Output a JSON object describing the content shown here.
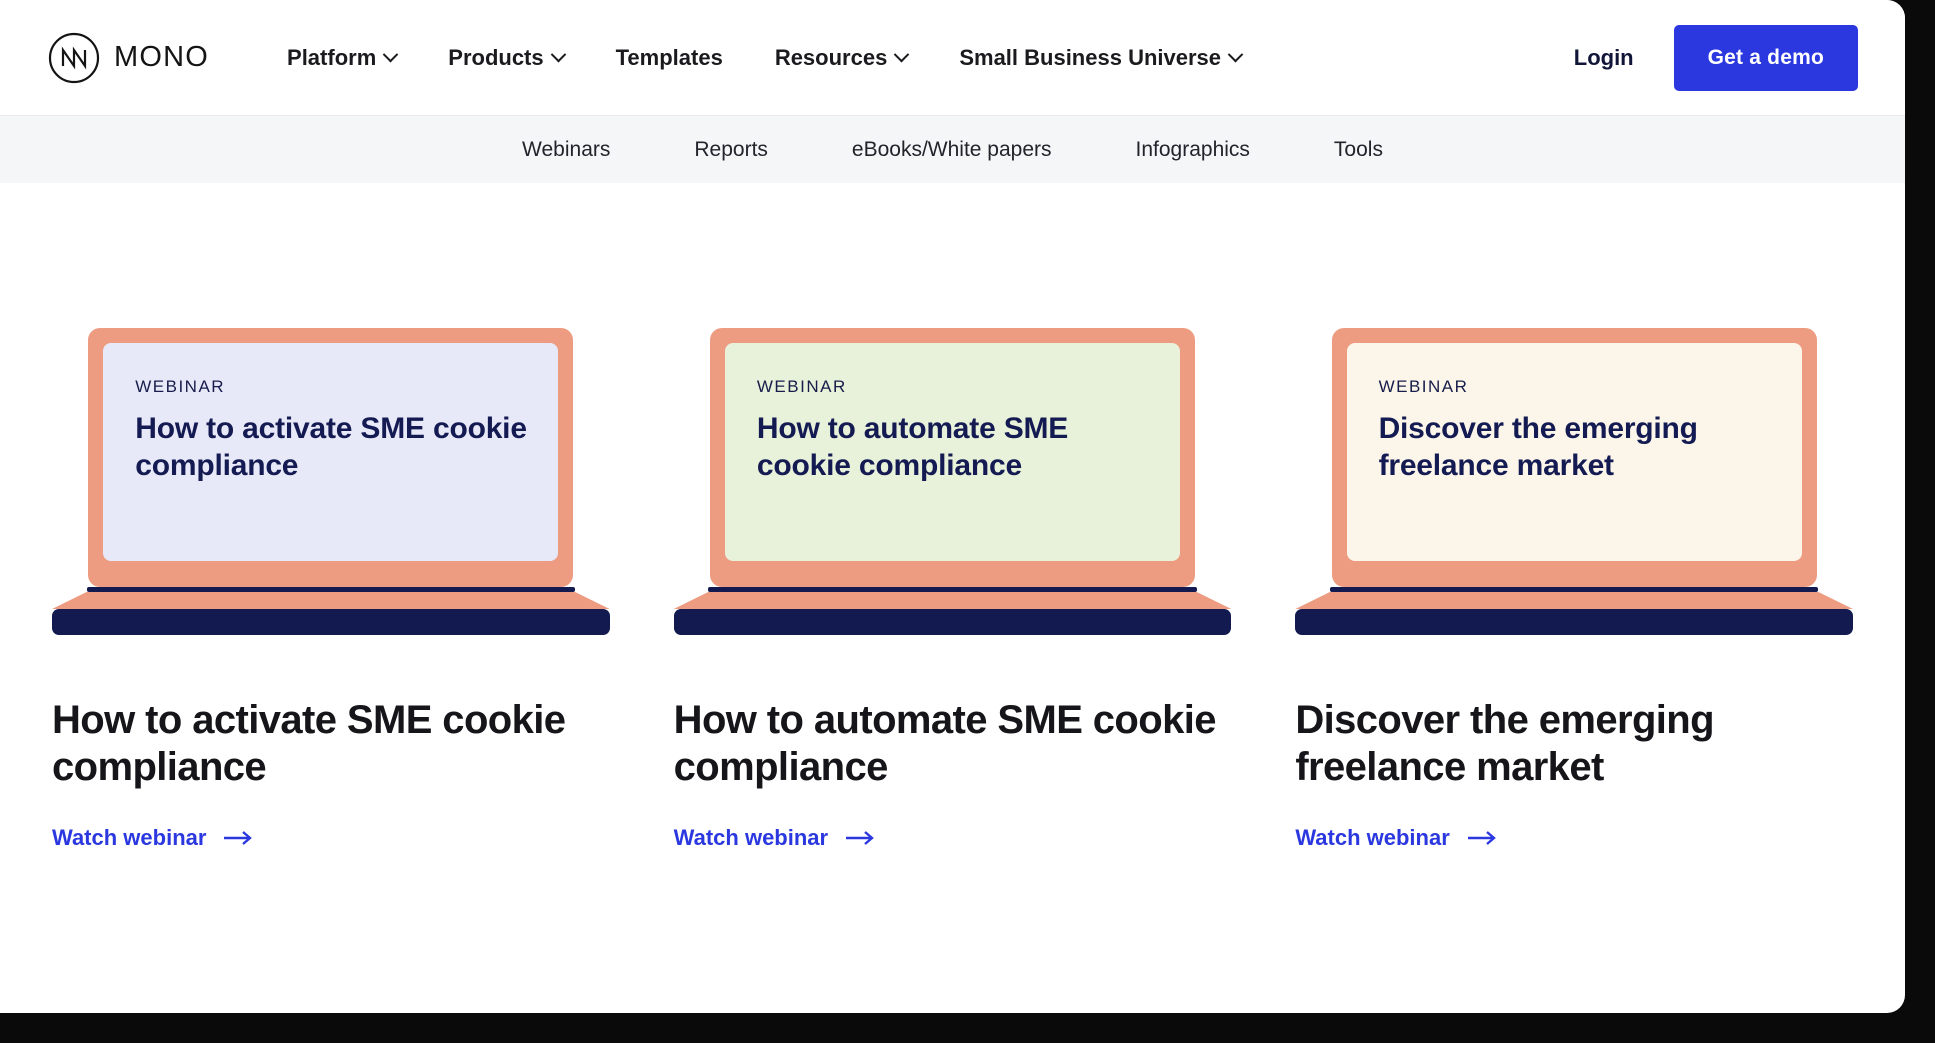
{
  "brand": {
    "logo_icon": "mono-circle-logo-icon",
    "wordmark": "MONO"
  },
  "topnav": {
    "items": [
      {
        "label": "Platform",
        "has_dropdown": true,
        "icon": "chevron-down-icon"
      },
      {
        "label": "Products",
        "has_dropdown": true,
        "icon": "chevron-down-icon"
      },
      {
        "label": "Templates",
        "has_dropdown": false,
        "icon": ""
      },
      {
        "label": "Resources",
        "has_dropdown": true,
        "icon": "chevron-down-icon"
      },
      {
        "label": "Small Business Universe",
        "has_dropdown": true,
        "icon": "chevron-down-icon"
      }
    ],
    "login_label": "Login",
    "demo_label": "Get a demo",
    "demo_color": "#2b38e0"
  },
  "subnav": {
    "background": "#f5f6f8",
    "items": [
      {
        "label": "Webinars"
      },
      {
        "label": "Reports"
      },
      {
        "label": "eBooks/White papers"
      },
      {
        "label": "Infographics"
      },
      {
        "label": "Tools"
      }
    ]
  },
  "cards": [
    {
      "screen_kicker": "WEBINAR",
      "screen_title": "How to activate SME cookie compliance",
      "screen_bg": "#e8e9f8",
      "lid_color": "#ed9c81",
      "base_color": "#121a4f",
      "title": "How to activate SME cookie compliance",
      "link_label": "Watch webinar",
      "link_icon": "arrow-right-icon",
      "link_color": "#2b38e0"
    },
    {
      "screen_kicker": "WEBINAR",
      "screen_title": "How to automate SME cookie compliance",
      "screen_bg": "#e8f1d9",
      "lid_color": "#ed9c81",
      "base_color": "#121a4f",
      "title": "How to automate SME cookie compliance",
      "link_label": "Watch webinar",
      "link_icon": "arrow-right-icon",
      "link_color": "#2b38e0"
    },
    {
      "screen_kicker": "WEBINAR",
      "screen_title": "Discover the emerging freelance market",
      "screen_bg": "#fbf6e9",
      "lid_color": "#ed9c81",
      "base_color": "#121a4f",
      "title": "Discover the emerging freelance market",
      "link_label": "Watch webinar",
      "link_icon": "arrow-right-icon",
      "link_color": "#2b38e0"
    }
  ]
}
